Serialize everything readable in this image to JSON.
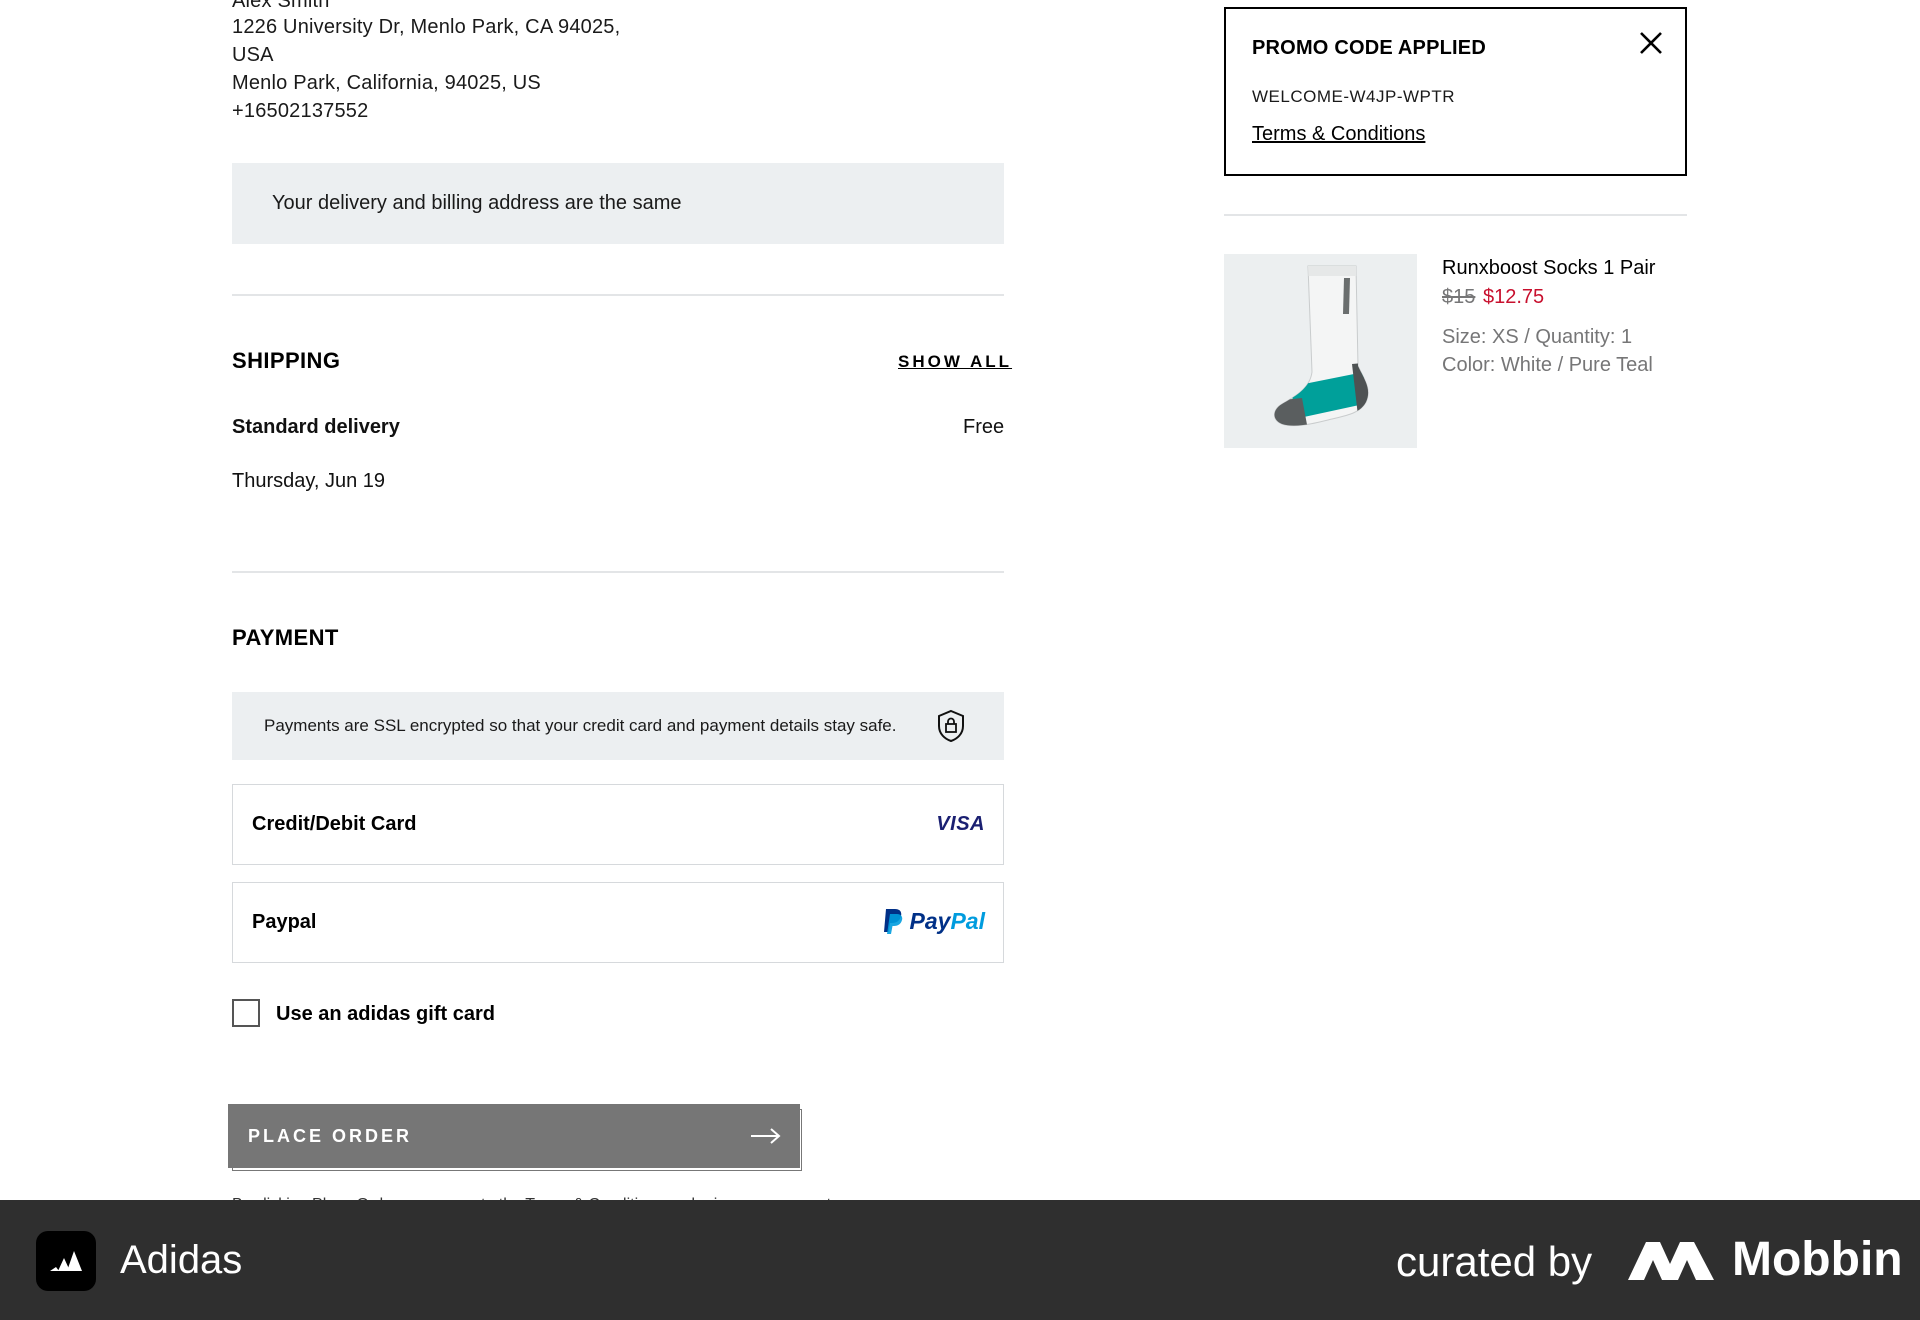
{
  "address": {
    "name": "Alex Smith",
    "line1": "1226 University Dr, Menlo Park, CA 94025,",
    "line2": "USA",
    "line3": "Menlo Park, California, 94025, US",
    "phone": "+16502137552",
    "same_notice": "Your delivery and billing address are the same"
  },
  "shipping": {
    "title": "SHIPPING",
    "show_all": "SHOW ALL",
    "method": "Standard delivery",
    "price": "Free",
    "date": "Thursday, Jun 19"
  },
  "payment": {
    "title": "PAYMENT",
    "ssl_notice": "Payments are SSL encrypted so that your credit card and payment details stay safe.",
    "options": [
      {
        "label": "Credit/Debit Card",
        "brand": "VISA"
      },
      {
        "label": "Paypal",
        "brand_a": "Pay",
        "brand_b": "Pal"
      }
    ],
    "gift_card_label": "Use an adidas gift card"
  },
  "place_order": {
    "label": "PLACE ORDER",
    "legal_text": "By clicking Place Order, you agree to the Terms & Conditions and privacy agreement"
  },
  "promo": {
    "title": "PROMO CODE APPLIED",
    "code": "WELCOME-W4JP-WPTR",
    "terms": "Terms & Conditions"
  },
  "product": {
    "name": "Runxboost Socks 1 Pair",
    "price_original": "$15",
    "price_sale": "$12.75",
    "size_qty": "Size: XS / Quantity: 1",
    "color": "Color: White / Pure Teal"
  },
  "footer": {
    "app_name": "Adidas",
    "curated_by": "curated by",
    "brand": "Mobbin"
  },
  "colors": {
    "sale_price": "#c8102e",
    "button_disabled": "#767676",
    "notice_bg": "#eceff1",
    "footer_bg": "#2f2f2f",
    "sock_teal": "#00a09a"
  }
}
